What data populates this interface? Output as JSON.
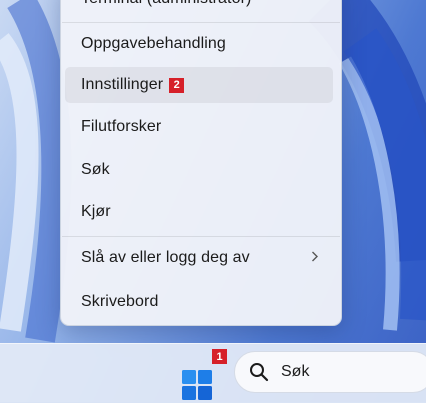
{
  "context_menu": {
    "items": [
      {
        "label": "Terminal (administrator)"
      },
      {
        "label": "Oppgavebehandling"
      },
      {
        "label": "Innstillinger",
        "badge": "2"
      },
      {
        "label": "Filutforsker"
      },
      {
        "label": "Søk"
      },
      {
        "label": "Kjør"
      },
      {
        "label": "Slå av eller logg deg av",
        "submenu_icon": "chevron-right-icon"
      },
      {
        "label": "Skrivebord"
      }
    ]
  },
  "taskbar": {
    "start_badge": "1",
    "search_label": "Søk"
  },
  "colors": {
    "badge": "#d62029",
    "start_blue": "#1a73e8"
  }
}
